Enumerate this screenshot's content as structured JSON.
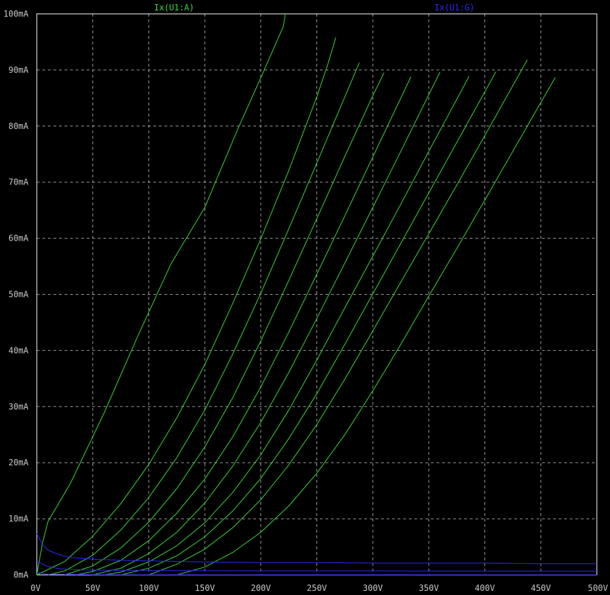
{
  "chart_data": {
    "type": "line",
    "title": "",
    "xlabel": "",
    "ylabel": "",
    "xlim": [
      0,
      500
    ],
    "ylim": [
      0,
      100
    ],
    "grid": true,
    "x_ticks": [
      0,
      50,
      100,
      150,
      200,
      250,
      300,
      350,
      400,
      450,
      500
    ],
    "x_tick_labels": [
      "0V",
      "50V",
      "100V",
      "150V",
      "200V",
      "250V",
      "300V",
      "350V",
      "400V",
      "450V",
      "500V"
    ],
    "y_ticks": [
      0,
      10,
      20,
      30,
      40,
      50,
      60,
      70,
      80,
      90,
      100
    ],
    "y_tick_labels": [
      "0mA",
      "10mA",
      "20mA",
      "30mA",
      "40mA",
      "50mA",
      "60mA",
      "70mA",
      "80mA",
      "90mA",
      "100mA"
    ],
    "legend": [
      {
        "label": "Ix(U1:A)",
        "color": "#3cd83c"
      },
      {
        "label": "Ix(U1:G)",
        "color": "#2a2aff"
      }
    ],
    "colors": {
      "background": "#000000",
      "frame": "#ffffff",
      "grid": "#9a9a9a",
      "text": "#c8c8c8",
      "anode": "#3cd83c",
      "grid_current": "#2a2aff"
    },
    "series": [
      {
        "group": "Ix(U1:A)",
        "x": [
          0,
          5,
          10,
          30,
          60,
          90,
          120,
          150,
          180,
          200,
          220,
          222
        ],
        "y": [
          0,
          5.6,
          9.5,
          16.3,
          28.8,
          42.5,
          55.5,
          65.5,
          79.7,
          88.6,
          97.7,
          100
        ]
      },
      {
        "group": "Ix(U1:A)",
        "x": [
          0,
          25,
          50,
          75,
          100,
          125,
          150,
          175,
          200,
          225,
          250,
          260,
          267
        ],
        "y": [
          0,
          2.4,
          6.9,
          12.7,
          19.7,
          28.0,
          37.5,
          48.4,
          59.9,
          72.1,
          85.2,
          91.1,
          95.8
        ]
      },
      {
        "group": "Ix(U1:A)",
        "x": [
          10,
          25,
          50,
          75,
          100,
          125,
          150,
          175,
          200,
          225,
          250,
          275,
          288
        ],
        "y": [
          0,
          0.7,
          3.5,
          8.0,
          13.8,
          20.9,
          29.4,
          39.4,
          50.2,
          61.7,
          73.4,
          85.2,
          91.3
        ]
      },
      {
        "group": "Ix(U1:A)",
        "x": [
          25,
          50,
          75,
          100,
          125,
          150,
          175,
          200,
          225,
          250,
          275,
          300,
          310
        ],
        "y": [
          0,
          1.6,
          4.8,
          9.4,
          15.4,
          22.8,
          31.6,
          41.7,
          52.5,
          63.5,
          74.6,
          85.4,
          89.5
        ]
      },
      {
        "group": "Ix(U1:A)",
        "x": [
          35,
          50,
          75,
          100,
          125,
          150,
          175,
          200,
          225,
          250,
          275,
          300,
          325,
          334
        ],
        "y": [
          0,
          0.6,
          2.6,
          6.1,
          11.0,
          17.1,
          24.6,
          33.5,
          43.3,
          53.6,
          64.0,
          74.5,
          85.0,
          88.8
        ]
      },
      {
        "group": "Ix(U1:A)",
        "x": [
          50,
          75,
          100,
          125,
          150,
          175,
          200,
          225,
          250,
          275,
          300,
          325,
          350,
          360
        ],
        "y": [
          0,
          1.2,
          3.8,
          7.6,
          12.8,
          19.4,
          27.2,
          36.1,
          45.7,
          55.6,
          65.5,
          75.5,
          85.6,
          89.6
        ]
      },
      {
        "group": "Ix(U1:A)",
        "x": [
          60,
          75,
          100,
          125,
          150,
          175,
          200,
          225,
          250,
          275,
          300,
          325,
          350,
          375,
          386
        ],
        "y": [
          0,
          0.5,
          2.3,
          5.2,
          9.3,
          14.7,
          21.4,
          29.4,
          38.3,
          47.6,
          56.8,
          66.1,
          75.5,
          84.8,
          88.9
        ]
      },
      {
        "group": "Ix(U1:A)",
        "x": [
          75,
          100,
          125,
          150,
          175,
          200,
          225,
          250,
          275,
          300,
          325,
          350,
          375,
          400,
          410
        ],
        "y": [
          0,
          1.2,
          3.4,
          6.8,
          11.4,
          17.2,
          24.3,
          32.3,
          41.1,
          50.1,
          59.1,
          68.1,
          77.1,
          86.1,
          89.7
        ]
      },
      {
        "group": "Ix(U1:A)",
        "x": [
          100,
          125,
          150,
          175,
          200,
          225,
          250,
          275,
          300,
          325,
          350,
          375,
          400,
          425,
          438
        ],
        "y": [
          0,
          1.9,
          4.6,
          8.4,
          13.4,
          19.6,
          26.8,
          34.9,
          43.5,
          52.2,
          60.8,
          69.5,
          78.3,
          87.2,
          91.8
        ]
      },
      {
        "group": "Ix(U1:A)",
        "x": [
          125,
          150,
          175,
          200,
          225,
          250,
          275,
          300,
          325,
          350,
          375,
          400,
          425,
          450,
          463
        ],
        "y": [
          0,
          1.4,
          4.0,
          7.6,
          12.3,
          18.1,
          25.0,
          32.8,
          41.1,
          49.7,
          58.2,
          66.8,
          75.5,
          84.2,
          88.7
        ]
      },
      {
        "group": "Ix(U1:G)",
        "x": [
          0,
          5,
          10,
          20,
          30,
          50,
          75,
          100,
          125,
          150,
          200,
          250,
          300,
          350,
          400,
          450,
          500
        ],
        "y": [
          7.3,
          5.5,
          4.4,
          3.6,
          3.1,
          2.8,
          2.6,
          2.5,
          2.4,
          2.3,
          2.2,
          2.2,
          2.1,
          2.1,
          2.1,
          2.0,
          2.0
        ]
      },
      {
        "group": "Ix(U1:G)",
        "x": [
          0,
          5,
          10,
          20,
          30,
          50,
          100,
          150,
          200,
          300,
          400,
          500
        ],
        "y": [
          2.6,
          1.9,
          1.5,
          1.1,
          0.95,
          0.85,
          0.8,
          0.75,
          0.72,
          0.7,
          0.68,
          0.65
        ]
      },
      {
        "group": "Ix(U1:G)",
        "x": [
          0,
          5,
          10,
          50,
          100,
          200,
          300,
          400,
          500
        ],
        "y": [
          0.5,
          0.25,
          0.12,
          0.05,
          0.04,
          0.03,
          0.03,
          0.03,
          0.03
        ]
      }
    ]
  }
}
